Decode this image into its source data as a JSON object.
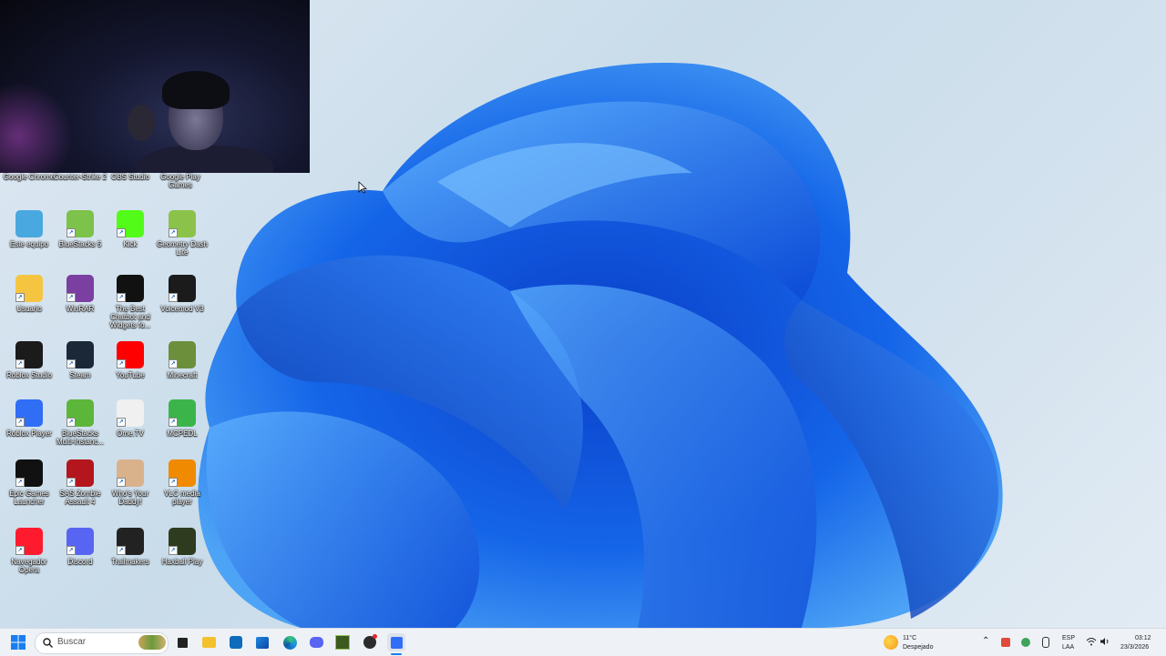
{
  "desktop": {
    "top_row_labels": [
      "Google Chrome",
      "Counter-Strike 2",
      "OBS Studio",
      "Google Play Games"
    ],
    "icons": [
      {
        "label": "Este equipo",
        "icon": "monitor-icon",
        "color": "#4aa8e0"
      },
      {
        "label": "BlueStacks 5",
        "icon": "bluestacks-icon",
        "color": "#7cc24b"
      },
      {
        "label": "Kick",
        "icon": "kick-icon",
        "color": "#53fc18"
      },
      {
        "label": "Geometry Dash Lite",
        "icon": "geometry-dash-icon",
        "color": "#8bc34a"
      },
      {
        "label": "Usuario",
        "icon": "folder-icon",
        "color": "#f5c542"
      },
      {
        "label": "WinRAR",
        "icon": "winrar-icon",
        "color": "#7b3fa1"
      },
      {
        "label": "The Best Chatbot and Widgets fo...",
        "icon": "chatbot-icon",
        "color": "#111111"
      },
      {
        "label": "Voicemod V3",
        "icon": "voicemod-icon",
        "color": "#1b1b1b"
      },
      {
        "label": "Roblox Studio",
        "icon": "roblox-studio-icon",
        "color": "#1b1b1b"
      },
      {
        "label": "Steam",
        "icon": "steam-icon",
        "color": "#1b2838"
      },
      {
        "label": "YouTube",
        "icon": "youtube-icon",
        "color": "#ff0000"
      },
      {
        "label": "Minecraft",
        "icon": "minecraft-icon",
        "color": "#6b8f3a"
      },
      {
        "label": "Roblox Player",
        "icon": "roblox-player-icon",
        "color": "#2f6ef5"
      },
      {
        "label": "BlueStacks Multi-Instanc...",
        "icon": "bluestacks-multi-icon",
        "color": "#5cb63a"
      },
      {
        "label": "Ome.TV",
        "icon": "ometv-icon",
        "color": "#f0f0f0"
      },
      {
        "label": "MCPEDL",
        "icon": "mcpedl-icon",
        "color": "#3bb54a"
      },
      {
        "label": "Epic Games Launcher",
        "icon": "epic-games-icon",
        "color": "#111111"
      },
      {
        "label": "SAS Zombie Assault 4",
        "icon": "sas-zombie-icon",
        "color": "#b3161c"
      },
      {
        "label": "Who's Your Daddy!",
        "icon": "whos-your-daddy-icon",
        "color": "#d9b28c"
      },
      {
        "label": "VLC media player",
        "icon": "vlc-icon",
        "color": "#f08a00"
      },
      {
        "label": "Navegador Opera",
        "icon": "opera-icon",
        "color": "#ff1b2d"
      },
      {
        "label": "Discord",
        "icon": "discord-icon",
        "color": "#5865f2"
      },
      {
        "label": "Trailmakers",
        "icon": "trailmakers-icon",
        "color": "#222222"
      },
      {
        "label": "Haxball Play",
        "icon": "haxball-icon",
        "color": "#2e3b1f"
      }
    ]
  },
  "taskbar": {
    "search_placeholder": "Buscar",
    "weather_temp": "11°C",
    "weather_desc": "Despejado",
    "lang_line1": "ESP",
    "lang_line2": "LAA",
    "time": "03:12",
    "date": "23/3/2026",
    "apps": [
      "start-icon",
      "search-icon",
      "widgets-icon",
      "task-view-icon",
      "file-explorer-icon",
      "outlook-icon",
      "microsoft-store-icon",
      "edge-icon",
      "discord-icon",
      "minecraft-launcher-icon",
      "obs-icon",
      "roblox-icon"
    ]
  }
}
